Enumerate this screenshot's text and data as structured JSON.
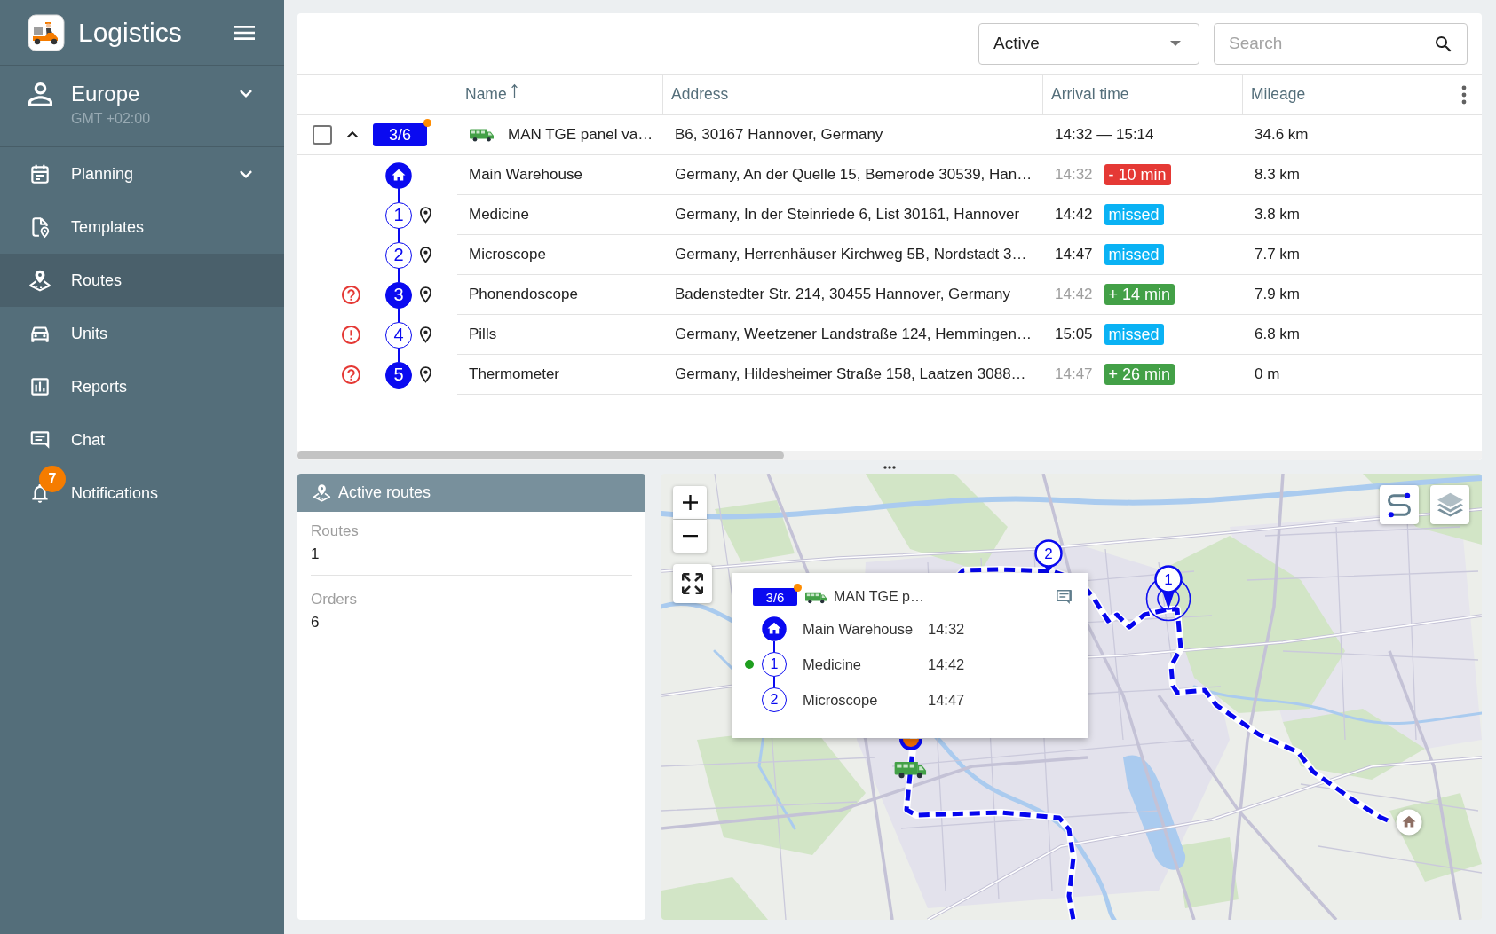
{
  "sidebar": {
    "brand": "Logistics",
    "account": {
      "name": "Europe",
      "timezone": "GMT +02:00",
      "expanded": false
    },
    "items": [
      {
        "kind": "planning",
        "label": "Planning",
        "submenu": true,
        "selected": false
      },
      {
        "kind": "templates",
        "label": "Templates",
        "submenu": false,
        "selected": false
      },
      {
        "kind": "routes",
        "label": "Routes",
        "submenu": false,
        "selected": true
      },
      {
        "kind": "units",
        "label": "Units",
        "submenu": false,
        "selected": false
      },
      {
        "kind": "reports",
        "label": "Reports",
        "submenu": false,
        "selected": false
      },
      {
        "kind": "chat",
        "label": "Chat",
        "submenu": false,
        "selected": false
      },
      {
        "kind": "notifications",
        "label": "Notifications",
        "submenu": false,
        "selected": false,
        "badge": "7"
      }
    ]
  },
  "toolbar": {
    "filter": {
      "value": "Active"
    },
    "search": {
      "placeholder": "Search"
    }
  },
  "table": {
    "columns": [
      {
        "label": "Name",
        "sorted": true
      },
      {
        "label": "Address",
        "sorted": false
      },
      {
        "label": "Arrival time",
        "sorted": false
      },
      {
        "label": "Mileage",
        "sorted": false
      }
    ],
    "route": {
      "checked": false,
      "expanded": true,
      "progress": "3/6",
      "alert": true,
      "vehicle": "MAN TGE panel va…",
      "address": "B6, 30167 Hannover, Germany",
      "arrival": "14:32 — 15:14",
      "mileage": "34.6 km",
      "stops": [
        {
          "kind": "warehouse",
          "visited": true,
          "name": "Main Warehouse",
          "address": "Germany, An der Quelle 15, Bemerode 30539, Han…",
          "time": "14:32",
          "deviation": {
            "kind": "negative",
            "text": "- 10 min"
          },
          "mileage": "8.3 km"
        },
        {
          "kind": "order",
          "number": "1",
          "visited": false,
          "name": "Medicine",
          "address": "Germany, In der Steinriede 6, List 30161, Hannover",
          "time": "14:42",
          "deviation": {
            "kind": "missed",
            "text": "missed"
          },
          "mileage": "3.8 km"
        },
        {
          "kind": "order",
          "number": "2",
          "visited": false,
          "name": "Microscope",
          "address": "Germany, Herrenhäuser Kirchweg 5B, Nordstadt 3…",
          "time": "14:47",
          "deviation": {
            "kind": "missed",
            "text": "missed"
          },
          "mileage": "7.7 km"
        },
        {
          "kind": "order",
          "number": "3",
          "visited": true,
          "warning": {
            "kind": "question"
          },
          "name": "Phonendoscope",
          "address": "Badenstedter Str. 214, 30455 Hannover, Germany",
          "time": "14:42",
          "deviation": {
            "kind": "positive",
            "text": "+ 14 min"
          },
          "mileage": "7.9 km"
        },
        {
          "kind": "order",
          "number": "4",
          "visited": false,
          "warning": {
            "kind": "exclamation"
          },
          "name": "Pills",
          "address": "Germany, Weetzener Landstraße 124, Hemmingen…",
          "time": "15:05",
          "deviation": {
            "kind": "missed",
            "text": "missed"
          },
          "mileage": "6.8 km"
        },
        {
          "kind": "order",
          "number": "5",
          "visited": true,
          "warning": {
            "kind": "question"
          },
          "name": "Thermometer",
          "address": "Germany, Hildesheimer Straße 158, Laatzen 3088…",
          "time": "14:47",
          "deviation": {
            "kind": "positive",
            "text": "+ 26 min"
          },
          "mileage": "0 m"
        }
      ]
    }
  },
  "summary": {
    "title": "Active routes",
    "stats": [
      {
        "label": "Routes",
        "value": "1"
      },
      {
        "label": "Orders",
        "value": "6"
      }
    ]
  },
  "map": {
    "markers": [
      {
        "kind": "order",
        "number": "2",
        "selected": false
      },
      {
        "kind": "order",
        "number": "1",
        "selected": true
      },
      {
        "kind": "warehouse",
        "selected": false
      },
      {
        "kind": "stop",
        "selected": false
      },
      {
        "kind": "vehicle",
        "selected": false
      }
    ],
    "popup": {
      "progress": "3/6",
      "alert": true,
      "vehicle": "MAN TGE p…",
      "stops": [
        {
          "kind": "warehouse",
          "visited": true,
          "current": false,
          "name": "Main Warehouse",
          "time": "14:32"
        },
        {
          "kind": "order",
          "number": "1",
          "visited": false,
          "current": true,
          "name": "Medicine",
          "time": "14:42"
        },
        {
          "kind": "order",
          "number": "2",
          "visited": false,
          "current": false,
          "name": "Microscope",
          "time": "14:47"
        }
      ]
    }
  }
}
